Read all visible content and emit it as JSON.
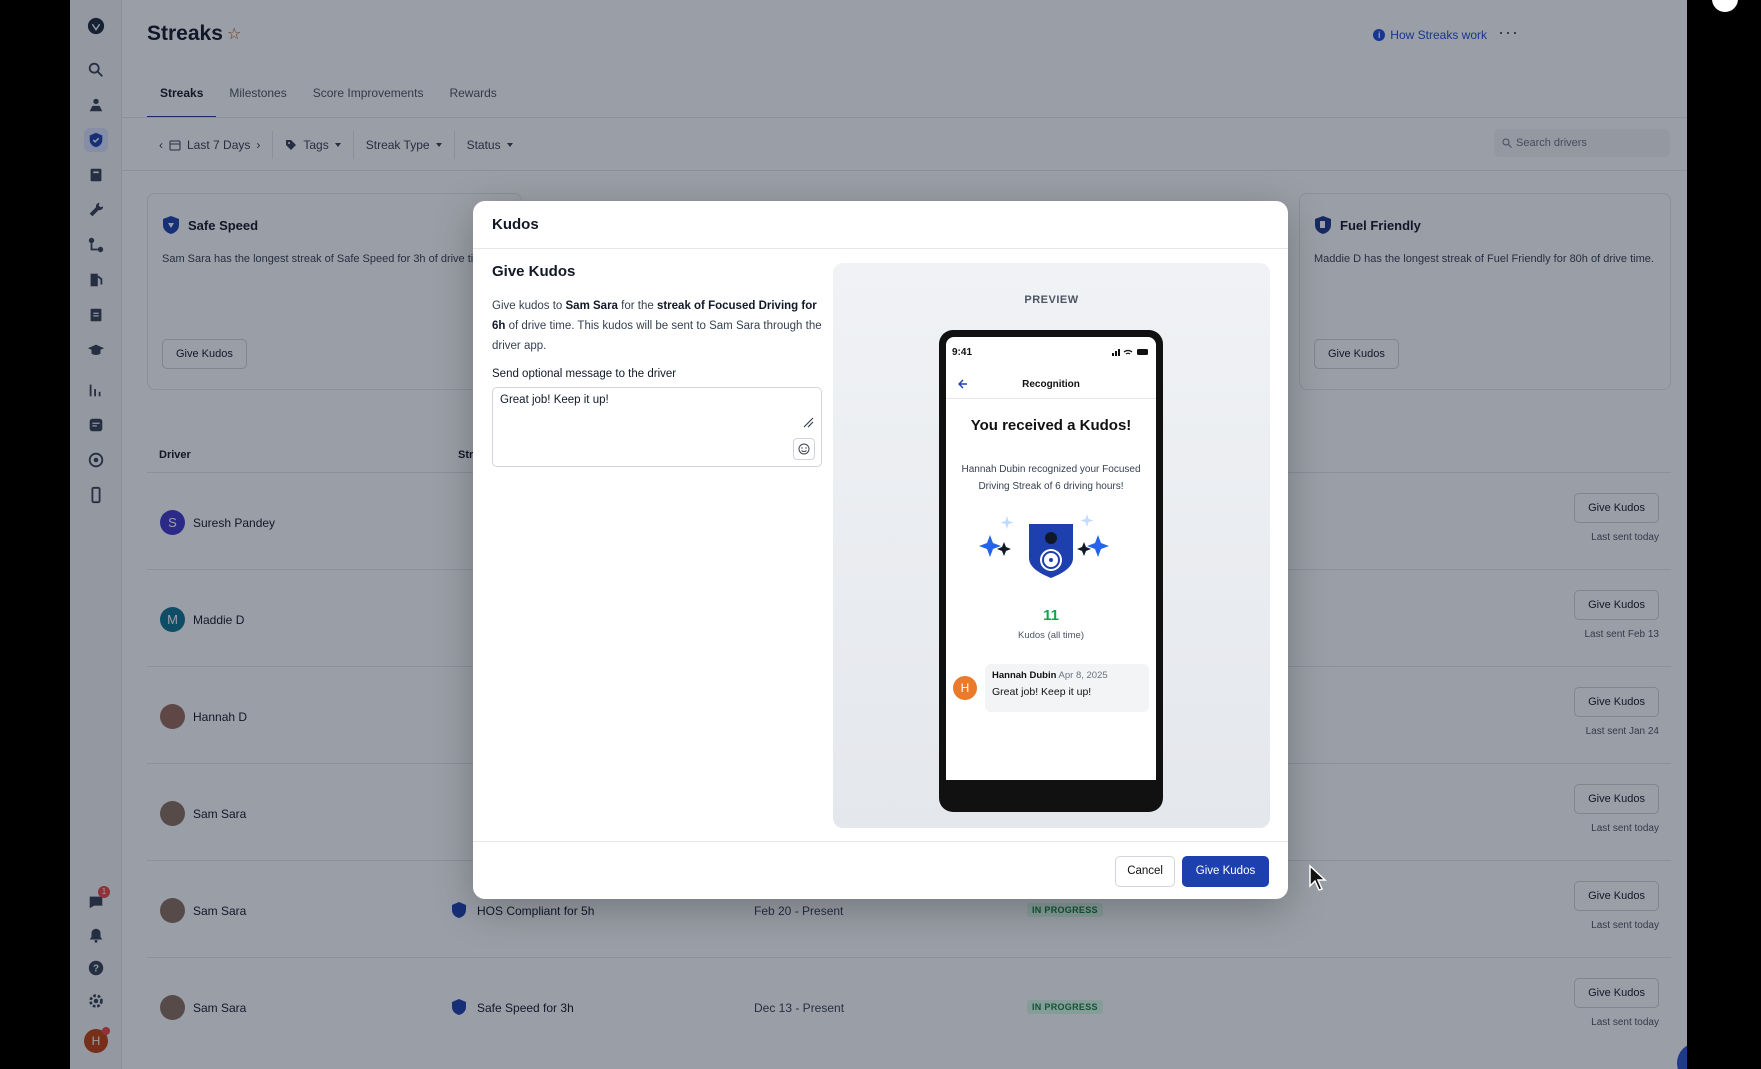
{
  "page": {
    "title": "Streaks",
    "how_link": "How Streaks work",
    "more": "···"
  },
  "tabs": [
    {
      "label": "Streaks",
      "active": true
    },
    {
      "label": "Milestones"
    },
    {
      "label": "Score Improvements"
    },
    {
      "label": "Rewards"
    }
  ],
  "filters": {
    "date_range": "Last 7 Days",
    "tags": "Tags",
    "streak_type": "Streak Type",
    "status": "Status",
    "search_placeholder": "Search drivers"
  },
  "cards": [
    {
      "title": "Safe Speed",
      "desc": "Sam Sara has the longest streak of Safe Speed for 3h of drive time.",
      "button": "Give Kudos"
    },
    {
      "title": "Fuel Friendly",
      "desc": "Maddie D has the longest streak of Fuel Friendly for 80h of drive time.",
      "button": "Give Kudos"
    }
  ],
  "table": {
    "col_driver": "Driver",
    "col_streak": "Str",
    "rows": [
      {
        "initial": "S",
        "name": "Suresh Pandey",
        "avatar_color": "#4338ca",
        "streak": "",
        "dates": "",
        "status": "",
        "button": "Give Kudos",
        "last_sent": "Last sent today"
      },
      {
        "initial": "M",
        "name": "Maddie D",
        "avatar_color": "#0e7490",
        "streak": "",
        "dates": "",
        "status": "",
        "button": "Give Kudos",
        "last_sent": "Last sent Feb 13"
      },
      {
        "initial": "",
        "name": "Hannah D",
        "avatar_color": "#9a6a5a",
        "streak": "",
        "dates": "",
        "status": "",
        "button": "Give Kudos",
        "last_sent": "Last sent Jan 24"
      },
      {
        "initial": "",
        "name": "Sam Sara",
        "avatar_color": "#8a7060",
        "streak": "",
        "dates": "",
        "status": "",
        "button": "Give Kudos",
        "last_sent": "Last sent today"
      },
      {
        "initial": "",
        "name": "Sam Sara",
        "avatar_color": "#8a7060",
        "streak": "HOS Compliant for 5h",
        "dates": "Feb 20 - Present",
        "status": "IN PROGRESS",
        "button": "Give Kudos",
        "last_sent": "Last sent today"
      },
      {
        "initial": "",
        "name": "Sam Sara",
        "avatar_color": "#8a7060",
        "streak": "Safe Speed for 3h",
        "dates": "Dec 13 - Present",
        "status": "IN PROGRESS",
        "button": "Give Kudos",
        "last_sent": "Last sent today"
      }
    ]
  },
  "sidebar": {
    "notification_count": "1",
    "user_initial": "H"
  },
  "modal": {
    "title": "Kudos",
    "heading": "Give Kudos",
    "desc_pre": "Give kudos to ",
    "desc_name": "Sam Sara",
    "desc_mid": " for the ",
    "desc_streak": "streak of Focused Driving for 6h",
    "desc_post": " of drive time. This kudos will be sent to Sam Sara through the driver app.",
    "message_label": "Send optional message to the driver",
    "message_value": "Great job! Keep it up!",
    "preview_label": "PREVIEW",
    "cancel": "Cancel",
    "submit": "Give Kudos"
  },
  "phone": {
    "time": "9:41",
    "nav_title": "Recognition",
    "headline": "You received a Kudos!",
    "subtext": "Hannah Dubin recognized your Focused Driving Streak of 6 driving hours!",
    "count": "11",
    "count_label": "Kudos (all time)",
    "msg_initial": "H",
    "msg_author": "Hannah Dubin",
    "msg_date": "Apr 8, 2025",
    "msg_text": "Great job! Keep it up!"
  },
  "colors": {
    "accent": "#1e40af",
    "status_green": "#15803d"
  }
}
